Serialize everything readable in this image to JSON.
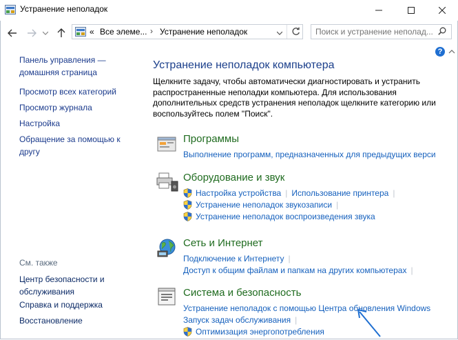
{
  "window": {
    "title": "Устранение неполадок",
    "controls": [
      "minimize",
      "maximize",
      "close"
    ]
  },
  "nav": {
    "breadcrumb": [
      "Все элеме...",
      "Устранение неполадок"
    ],
    "prefix": "«",
    "search_placeholder": "Поиск и устранение неполад..."
  },
  "sidebar": {
    "home_line1": "Панель управления —",
    "home_line2": "домашняя страница",
    "items": [
      "Просмотр всех категорий",
      "Просмотр журнала",
      "Настройка"
    ],
    "help_line1": "Обращение за помощью к",
    "help_line2": "другу",
    "see_also_label": "См. также",
    "see_also": {
      "security_line1": "Центр безопасности и",
      "security_line2": "обслуживания",
      "support": "Справка и поддержка",
      "recovery": "Восстановление"
    }
  },
  "main": {
    "title": "Устранение неполадок компьютера",
    "intro": "Щелкните задачу, чтобы автоматически диагностировать и устранить распространенные неполадки компьютера. Для использования дополнительных средств устранения неполадок щелкните категорию или воспользуйтесь полем \"Поиск\".",
    "categories": {
      "programs": {
        "title": "Программы",
        "link1": "Выполнение программ, предназначенных для предыдущих верси"
      },
      "hardware": {
        "title": "Оборудование и звук",
        "link1": "Настройка устройства",
        "link2": "Использование принтера",
        "link3": "Устранение неполадок звукозаписи",
        "link4": "Устранение неполадок воспроизведения звука"
      },
      "network": {
        "title": "Сеть и Интернет",
        "link1": "Подключение к Интернету",
        "link2": "Доступ к общим файлам и папкам на других компьютерах"
      },
      "system": {
        "title": "Система и безопасность",
        "link1": "Устранение неполадок с помощью Центра обновления Windows",
        "link2": "Запуск задач обслуживания",
        "link3": "Оптимизация энергопотребления"
      }
    }
  },
  "colors": {
    "link": "#1560bd",
    "category_title": "#1f6b1f",
    "main_title": "#1b3f8b",
    "annotation_arrow": "#1f6fd1"
  }
}
